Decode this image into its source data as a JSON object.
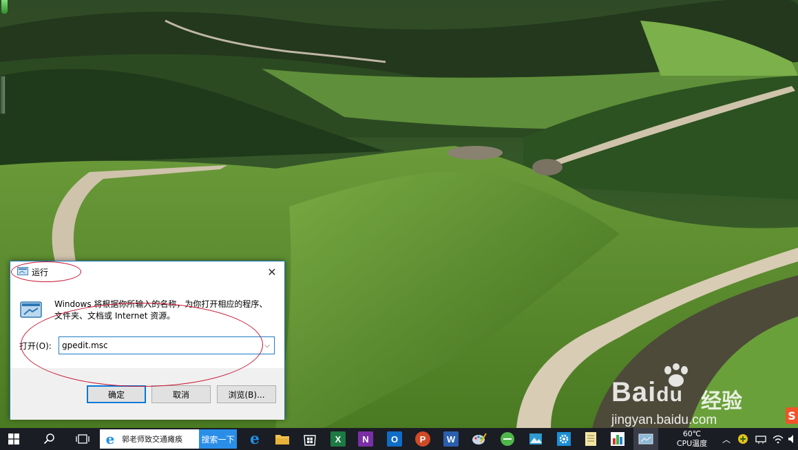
{
  "dialog": {
    "title": "运行",
    "description": "Windows 将根据你所输入的名称，为你打开相应的程序、文件夹、文档或 Internet 资源。",
    "open_label": "打开(O):",
    "input_value": "gpedit.msc",
    "ok_label": "确定",
    "cancel_label": "取消",
    "browse_label": "浏览(B)...",
    "close_glyph": "✕",
    "dropdown_glyph": "⌵"
  },
  "taskbar": {
    "search_text": "郭老师致交通瘫痪",
    "search_button": "搜索一下",
    "apps": [
      {
        "name": "edge",
        "icon": "edge-icon",
        "glyph": "e",
        "color": "#1e90e6"
      },
      {
        "name": "explorer",
        "icon": "folder-icon",
        "glyph": "",
        "color": "#f2c14e"
      },
      {
        "name": "store",
        "icon": "store-icon",
        "glyph": "",
        "color": "#ffffff"
      },
      {
        "name": "excel",
        "icon": "excel-icon",
        "glyph": "X",
        "color": "#1d7a43"
      },
      {
        "name": "onenote",
        "icon": "onenote-icon",
        "glyph": "N",
        "color": "#7b2fa6"
      },
      {
        "name": "outlook",
        "icon": "outlook-icon",
        "glyph": "O",
        "color": "#0f6cc7"
      },
      {
        "name": "powerpoint",
        "icon": "powerpoint-icon",
        "glyph": "P",
        "color": "#d04a26"
      },
      {
        "name": "word",
        "icon": "word-icon",
        "glyph": "W",
        "color": "#2b5fad"
      },
      {
        "name": "paint",
        "icon": "paint-icon",
        "glyph": "",
        "color": "#c8d6e8"
      },
      {
        "name": "green-app",
        "icon": "green-circle-icon",
        "glyph": "",
        "color": "#4fb64a"
      },
      {
        "name": "photos",
        "icon": "photos-icon",
        "glyph": "",
        "color": "#2e9ad1"
      },
      {
        "name": "settings-app",
        "icon": "gear-icon",
        "glyph": "",
        "color": "#1c8fd6"
      },
      {
        "name": "notepad",
        "icon": "notepad-icon",
        "glyph": "",
        "color": "#f3e6a5"
      },
      {
        "name": "chart-app",
        "icon": "chart-icon",
        "glyph": "",
        "color": "#5aa23c"
      },
      {
        "name": "run",
        "icon": "run-icon",
        "glyph": "",
        "color": "#8fb8d8"
      }
    ],
    "temp_value": "60℃",
    "temp_label": "CPU温度"
  },
  "watermark": {
    "brand_bai": "Bai",
    "brand_du": "du",
    "brand_cn": "经验",
    "url": "jingyan.baidu.com",
    "corner": "S"
  }
}
